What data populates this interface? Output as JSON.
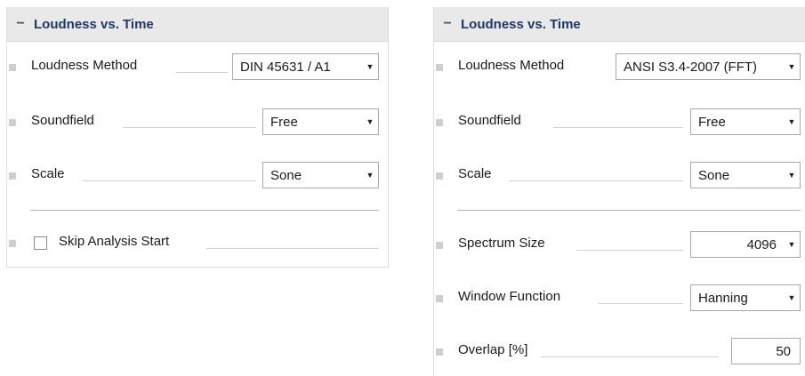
{
  "left_panel": {
    "title": "Loudness vs. Time",
    "collapse_icon": "minus-icon",
    "loudness_method": {
      "label": "Loudness Method",
      "value": "DIN 45631 / A1"
    },
    "soundfield": {
      "label": "Soundfield",
      "value": "Free"
    },
    "scale": {
      "label": "Scale",
      "value": "Sone"
    },
    "skip_analysis_start": {
      "label": "Skip Analysis Start",
      "checked": false
    }
  },
  "right_panel": {
    "title": "Loudness vs. Time",
    "collapse_icon": "minus-icon",
    "loudness_method": {
      "label": "Loudness Method",
      "value": "ANSI S3.4-2007 (FFT)"
    },
    "soundfield": {
      "label": "Soundfield",
      "value": "Free"
    },
    "scale": {
      "label": "Scale",
      "value": "Sone"
    },
    "spectrum_size": {
      "label": "Spectrum Size",
      "value": "4096"
    },
    "window_function": {
      "label": "Window Function",
      "value": "Hanning"
    },
    "overlap": {
      "label": "Overlap [%]",
      "value": "50"
    }
  },
  "colors": {
    "header_bg": "#e9e9e9",
    "header_text": "#1f3864",
    "grip": "#cfcfcf"
  }
}
